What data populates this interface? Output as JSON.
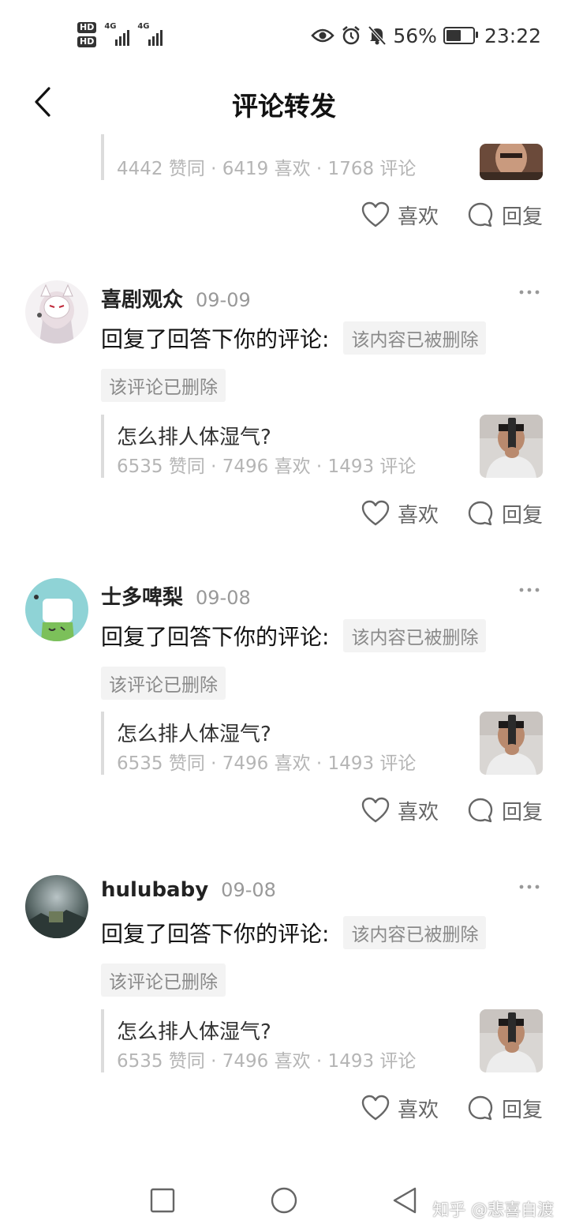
{
  "status_bar": {
    "hd1": "HD",
    "hd2": "HD",
    "net1": "4G",
    "net2": "4G",
    "battery_percent": "56%",
    "battery_level": 0.56,
    "time": "23:22",
    "icons": [
      "eye-icon",
      "alarm-icon",
      "mute-icon"
    ]
  },
  "header": {
    "title": "评论转发"
  },
  "top_partial": {
    "stats": "4442 赞同 · 6419 喜欢 · 1768 评论",
    "like_label": "喜欢",
    "reply_label": "回复"
  },
  "items": [
    {
      "user": "喜剧观众",
      "date": "09-09",
      "reply_text": "回复了回答下你的评论:",
      "content_tag": "该内容已被删除",
      "deleted_tag": "该评论已删除",
      "quote_title": "怎么排人体湿气?",
      "quote_stats": "6535 赞同 · 7496 喜欢 · 1493 评论",
      "like_label": "喜欢",
      "reply_label": "回复"
    },
    {
      "user": "士多啤梨",
      "date": "09-08",
      "reply_text": "回复了回答下你的评论:",
      "content_tag": "该内容已被删除",
      "deleted_tag": "该评论已删除",
      "quote_title": "怎么排人体湿气?",
      "quote_stats": "6535 赞同 · 7496 喜欢 · 1493 评论",
      "like_label": "喜欢",
      "reply_label": "回复"
    },
    {
      "user": "hulubaby",
      "date": "09-08",
      "reply_text": "回复了回答下你的评论:",
      "content_tag": "该内容已被删除",
      "deleted_tag": "该评论已删除",
      "quote_title": "怎么排人体湿气?",
      "quote_stats": "6535 赞同 · 7496 喜欢 · 1493 评论",
      "like_label": "喜欢",
      "reply_label": "回复"
    }
  ],
  "watermark": "知乎 @悲喜自渡",
  "colors": {
    "text_primary": "#121212",
    "text_secondary": "#999999",
    "stats_gray": "#b5b5b5",
    "tag_bg": "#f3f3f3",
    "quote_bar": "#dcdcdc"
  }
}
